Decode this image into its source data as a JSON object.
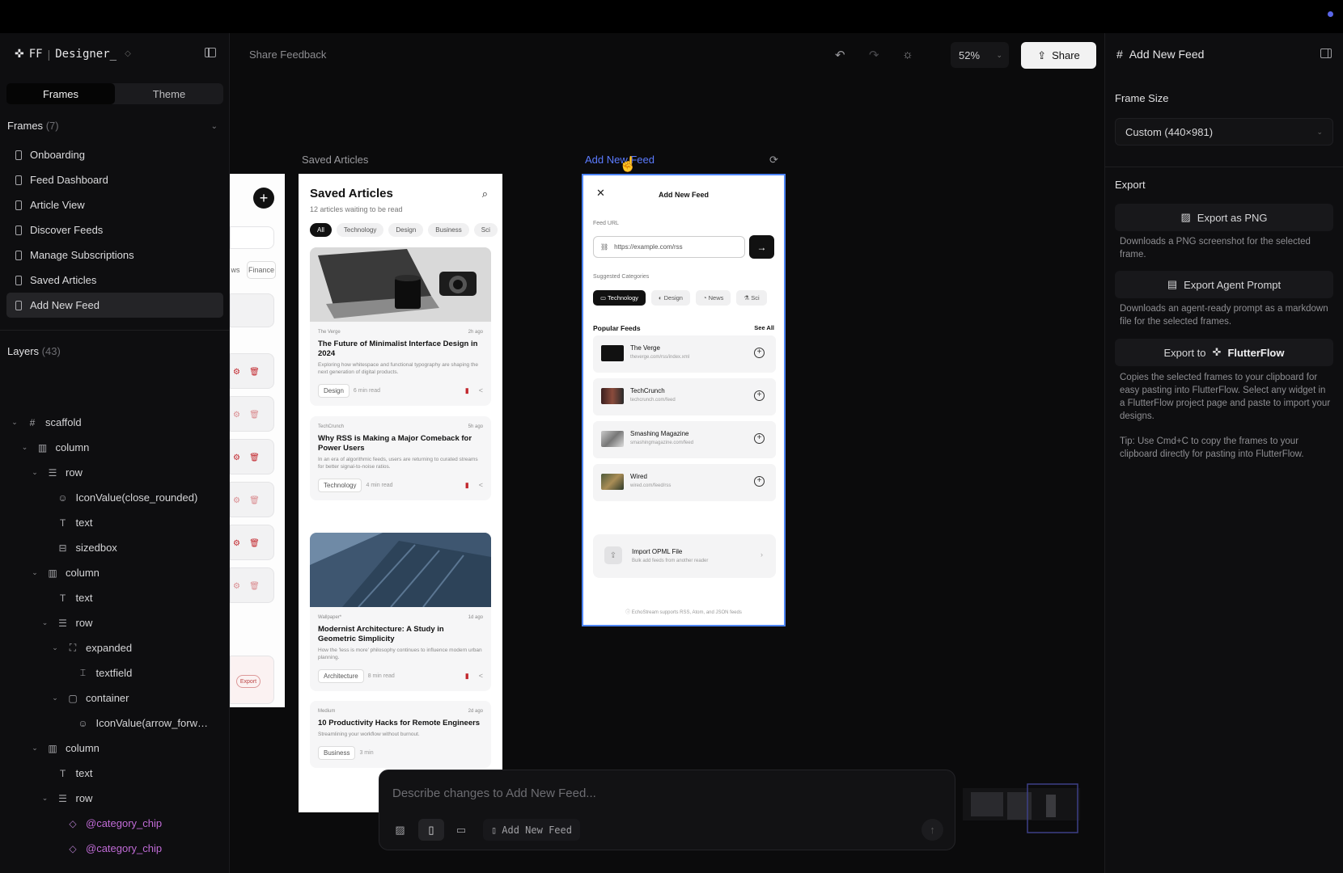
{
  "app": {
    "brand_prefix": "FF",
    "brand_name": "Designer_"
  },
  "left": {
    "tabs": [
      "Frames",
      "Theme"
    ],
    "frames_title": "Frames",
    "frames_count": "(7)",
    "frames": [
      "Onboarding",
      "Feed Dashboard",
      "Article View",
      "Discover Feeds",
      "Manage Subscriptions",
      "Saved Articles",
      "Add New Feed"
    ],
    "selected_frame": "Add New Feed",
    "layers_title": "Layers",
    "layers_count": "(43)",
    "layers": [
      {
        "label": "scaffold",
        "icon": "grid-icon"
      },
      {
        "label": "column",
        "icon": "column-icon"
      },
      {
        "label": "row",
        "icon": "row-icon"
      },
      {
        "label": "IconValue(close_rounded)",
        "icon": "icon-value-icon"
      },
      {
        "label": "text",
        "icon": "text-icon"
      },
      {
        "label": "sizedbox",
        "icon": "sizedbox-icon"
      },
      {
        "label": "column",
        "icon": "column-icon"
      },
      {
        "label": "text",
        "icon": "text-icon"
      },
      {
        "label": "row",
        "icon": "row-icon"
      },
      {
        "label": "expanded",
        "icon": "expanded-icon"
      },
      {
        "label": "textfield",
        "icon": "textfield-icon"
      },
      {
        "label": "container",
        "icon": "container-icon"
      },
      {
        "label": "IconValue(arrow_forw…",
        "icon": "icon-value-icon"
      },
      {
        "label": "column",
        "icon": "column-icon"
      },
      {
        "label": "text",
        "icon": "text-icon"
      },
      {
        "label": "row",
        "icon": "row-icon"
      },
      {
        "label": "@category_chip",
        "icon": "component-icon"
      },
      {
        "label": "@category_chip",
        "icon": "component-icon"
      }
    ]
  },
  "toolbar": {
    "share_feedback": "Share Feedback",
    "zoom": "52%",
    "share": "Share"
  },
  "canvas": {
    "partial_frame": {
      "chip": "Finance",
      "chip_partial": "ws",
      "export": "Export"
    },
    "saved_articles": {
      "label": "Saved Articles",
      "title": "Saved Articles",
      "subtitle": "12 articles waiting to be read",
      "chips": [
        "All",
        "Technology",
        "Design",
        "Business",
        "Sci"
      ],
      "articles": [
        {
          "source": "The Verge",
          "time": "2h ago",
          "title": "The Future of Minimalist Interface Design in 2024",
          "desc": "Exploring how whitespace and functional typography are shaping the next generation of digital products.",
          "tag": "Design",
          "read": "6 min read"
        },
        {
          "source": "TechCrunch",
          "time": "5h ago",
          "title": "Why RSS is Making a Major Comeback for Power Users",
          "desc": "In an era of algorithmic feeds, users are returning to curated streams for better signal-to-noise ratios.",
          "tag": "Technology",
          "read": "4 min read"
        },
        {
          "source": "Wallpaper*",
          "time": "1d ago",
          "title": "Modernist Architecture: A Study in Geometric Simplicity",
          "desc": "How the 'less is more' philosophy continues to influence modern urban planning.",
          "tag": "Architecture",
          "read": "8 min read"
        },
        {
          "source": "Medium",
          "time": "2d ago",
          "title": "10 Productivity Hacks for Remote Engineers",
          "desc": "Streamlining your workflow without burnout.",
          "tag": "Business",
          "read": "3 min"
        }
      ]
    },
    "add_new_feed": {
      "label": "Add New Feed",
      "title": "Add New Feed",
      "feed_url_label": "Feed URL",
      "url_placeholder": "https://example.com/rss",
      "suggested_label": "Suggested Categories",
      "categories": [
        "Technology",
        "Design",
        "News",
        "Sci"
      ],
      "popular_label": "Popular Feeds",
      "see_all": "See All",
      "feeds": [
        {
          "name": "The Verge",
          "url": "theverge.com/rss/index.xml"
        },
        {
          "name": "TechCrunch",
          "url": "techcrunch.com/feed"
        },
        {
          "name": "Smashing Magazine",
          "url": "smashingmagazine.com/feed"
        },
        {
          "name": "Wired",
          "url": "wired.com/feed/rss"
        }
      ],
      "opml_title": "Import OPML File",
      "opml_desc": "Bulk add feeds from another reader",
      "footer": "EchoStream supports RSS, Atom, and JSON feeds"
    }
  },
  "prompt": {
    "placeholder": "Describe changes to Add New Feed...",
    "frame_chip": "Add New Feed"
  },
  "right": {
    "title": "Add New Feed",
    "frame_size_label": "Frame Size",
    "frame_size_value": "Custom (440×981)",
    "export_label": "Export",
    "export_png": "Export as PNG",
    "export_png_desc": "Downloads a PNG screenshot for the selected frame.",
    "export_agent": "Export Agent Prompt",
    "export_agent_desc": "Downloads an agent-ready prompt as a markdown file for the selected frames.",
    "export_to": "Export to",
    "flutterflow": "FlutterFlow",
    "export_ff_desc": "Copies the selected frames to your clipboard for easy pasting into FlutterFlow. Select any widget in a FlutterFlow project page and paste to import your designs.",
    "tip": "Tip: Use Cmd+C to copy the frames to your clipboard directly for pasting into FlutterFlow."
  },
  "colors": {
    "accent": "#4e86ff",
    "bookmark": "#c2272d",
    "component": "#c06bd6"
  }
}
